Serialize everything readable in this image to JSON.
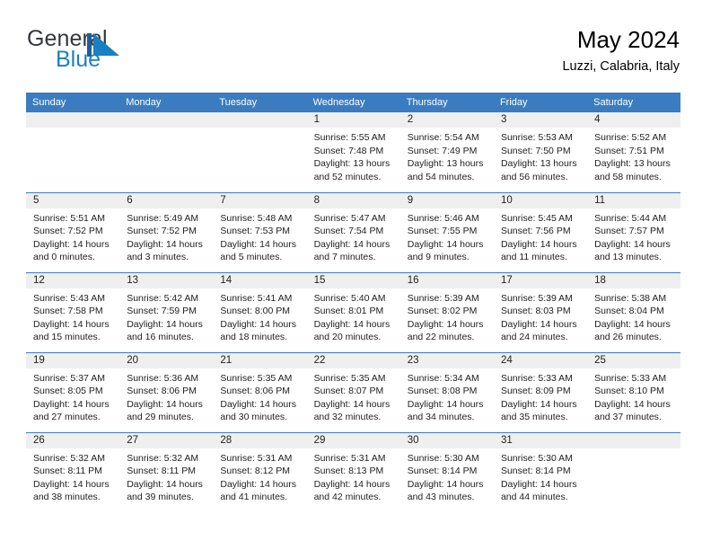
{
  "brand": {
    "name_top": "General",
    "name_bottom": "Blue",
    "mark": "triangle-logo",
    "color_dark": "#33383c",
    "color_blue": "#1b7fc4"
  },
  "header": {
    "title": "May 2024",
    "subtitle": "Luzzi, Calabria, Italy"
  },
  "theme": {
    "header_blue": "#3a7cbf",
    "daynum_band": "#efefef",
    "text": "#222222"
  },
  "weekdays": [
    "Sunday",
    "Monday",
    "Tuesday",
    "Wednesday",
    "Thursday",
    "Friday",
    "Saturday"
  ],
  "labels": {
    "sunrise": "Sunrise:",
    "sunset": "Sunset:",
    "daylight": "Daylight:"
  },
  "weeks": [
    [
      {
        "empty": true
      },
      {
        "empty": true
      },
      {
        "empty": true
      },
      {
        "day": "1",
        "sunrise": "Sunrise: 5:55 AM",
        "sunset": "Sunset: 7:48 PM",
        "daylight1": "Daylight: 13 hours",
        "daylight2": "and 52 minutes."
      },
      {
        "day": "2",
        "sunrise": "Sunrise: 5:54 AM",
        "sunset": "Sunset: 7:49 PM",
        "daylight1": "Daylight: 13 hours",
        "daylight2": "and 54 minutes."
      },
      {
        "day": "3",
        "sunrise": "Sunrise: 5:53 AM",
        "sunset": "Sunset: 7:50 PM",
        "daylight1": "Daylight: 13 hours",
        "daylight2": "and 56 minutes."
      },
      {
        "day": "4",
        "sunrise": "Sunrise: 5:52 AM",
        "sunset": "Sunset: 7:51 PM",
        "daylight1": "Daylight: 13 hours",
        "daylight2": "and 58 minutes."
      }
    ],
    [
      {
        "day": "5",
        "sunrise": "Sunrise: 5:51 AM",
        "sunset": "Sunset: 7:52 PM",
        "daylight1": "Daylight: 14 hours",
        "daylight2": "and 0 minutes."
      },
      {
        "day": "6",
        "sunrise": "Sunrise: 5:49 AM",
        "sunset": "Sunset: 7:52 PM",
        "daylight1": "Daylight: 14 hours",
        "daylight2": "and 3 minutes."
      },
      {
        "day": "7",
        "sunrise": "Sunrise: 5:48 AM",
        "sunset": "Sunset: 7:53 PM",
        "daylight1": "Daylight: 14 hours",
        "daylight2": "and 5 minutes."
      },
      {
        "day": "8",
        "sunrise": "Sunrise: 5:47 AM",
        "sunset": "Sunset: 7:54 PM",
        "daylight1": "Daylight: 14 hours",
        "daylight2": "and 7 minutes."
      },
      {
        "day": "9",
        "sunrise": "Sunrise: 5:46 AM",
        "sunset": "Sunset: 7:55 PM",
        "daylight1": "Daylight: 14 hours",
        "daylight2": "and 9 minutes."
      },
      {
        "day": "10",
        "sunrise": "Sunrise: 5:45 AM",
        "sunset": "Sunset: 7:56 PM",
        "daylight1": "Daylight: 14 hours",
        "daylight2": "and 11 minutes."
      },
      {
        "day": "11",
        "sunrise": "Sunrise: 5:44 AM",
        "sunset": "Sunset: 7:57 PM",
        "daylight1": "Daylight: 14 hours",
        "daylight2": "and 13 minutes."
      }
    ],
    [
      {
        "day": "12",
        "sunrise": "Sunrise: 5:43 AM",
        "sunset": "Sunset: 7:58 PM",
        "daylight1": "Daylight: 14 hours",
        "daylight2": "and 15 minutes."
      },
      {
        "day": "13",
        "sunrise": "Sunrise: 5:42 AM",
        "sunset": "Sunset: 7:59 PM",
        "daylight1": "Daylight: 14 hours",
        "daylight2": "and 16 minutes."
      },
      {
        "day": "14",
        "sunrise": "Sunrise: 5:41 AM",
        "sunset": "Sunset: 8:00 PM",
        "daylight1": "Daylight: 14 hours",
        "daylight2": "and 18 minutes."
      },
      {
        "day": "15",
        "sunrise": "Sunrise: 5:40 AM",
        "sunset": "Sunset: 8:01 PM",
        "daylight1": "Daylight: 14 hours",
        "daylight2": "and 20 minutes."
      },
      {
        "day": "16",
        "sunrise": "Sunrise: 5:39 AM",
        "sunset": "Sunset: 8:02 PM",
        "daylight1": "Daylight: 14 hours",
        "daylight2": "and 22 minutes."
      },
      {
        "day": "17",
        "sunrise": "Sunrise: 5:39 AM",
        "sunset": "Sunset: 8:03 PM",
        "daylight1": "Daylight: 14 hours",
        "daylight2": "and 24 minutes."
      },
      {
        "day": "18",
        "sunrise": "Sunrise: 5:38 AM",
        "sunset": "Sunset: 8:04 PM",
        "daylight1": "Daylight: 14 hours",
        "daylight2": "and 26 minutes."
      }
    ],
    [
      {
        "day": "19",
        "sunrise": "Sunrise: 5:37 AM",
        "sunset": "Sunset: 8:05 PM",
        "daylight1": "Daylight: 14 hours",
        "daylight2": "and 27 minutes."
      },
      {
        "day": "20",
        "sunrise": "Sunrise: 5:36 AM",
        "sunset": "Sunset: 8:06 PM",
        "daylight1": "Daylight: 14 hours",
        "daylight2": "and 29 minutes."
      },
      {
        "day": "21",
        "sunrise": "Sunrise: 5:35 AM",
        "sunset": "Sunset: 8:06 PM",
        "daylight1": "Daylight: 14 hours",
        "daylight2": "and 30 minutes."
      },
      {
        "day": "22",
        "sunrise": "Sunrise: 5:35 AM",
        "sunset": "Sunset: 8:07 PM",
        "daylight1": "Daylight: 14 hours",
        "daylight2": "and 32 minutes."
      },
      {
        "day": "23",
        "sunrise": "Sunrise: 5:34 AM",
        "sunset": "Sunset: 8:08 PM",
        "daylight1": "Daylight: 14 hours",
        "daylight2": "and 34 minutes."
      },
      {
        "day": "24",
        "sunrise": "Sunrise: 5:33 AM",
        "sunset": "Sunset: 8:09 PM",
        "daylight1": "Daylight: 14 hours",
        "daylight2": "and 35 minutes."
      },
      {
        "day": "25",
        "sunrise": "Sunrise: 5:33 AM",
        "sunset": "Sunset: 8:10 PM",
        "daylight1": "Daylight: 14 hours",
        "daylight2": "and 37 minutes."
      }
    ],
    [
      {
        "day": "26",
        "sunrise": "Sunrise: 5:32 AM",
        "sunset": "Sunset: 8:11 PM",
        "daylight1": "Daylight: 14 hours",
        "daylight2": "and 38 minutes."
      },
      {
        "day": "27",
        "sunrise": "Sunrise: 5:32 AM",
        "sunset": "Sunset: 8:11 PM",
        "daylight1": "Daylight: 14 hours",
        "daylight2": "and 39 minutes."
      },
      {
        "day": "28",
        "sunrise": "Sunrise: 5:31 AM",
        "sunset": "Sunset: 8:12 PM",
        "daylight1": "Daylight: 14 hours",
        "daylight2": "and 41 minutes."
      },
      {
        "day": "29",
        "sunrise": "Sunrise: 5:31 AM",
        "sunset": "Sunset: 8:13 PM",
        "daylight1": "Daylight: 14 hours",
        "daylight2": "and 42 minutes."
      },
      {
        "day": "30",
        "sunrise": "Sunrise: 5:30 AM",
        "sunset": "Sunset: 8:14 PM",
        "daylight1": "Daylight: 14 hours",
        "daylight2": "and 43 minutes."
      },
      {
        "day": "31",
        "sunrise": "Sunrise: 5:30 AM",
        "sunset": "Sunset: 8:14 PM",
        "daylight1": "Daylight: 14 hours",
        "daylight2": "and 44 minutes."
      },
      {
        "empty": true
      }
    ]
  ]
}
